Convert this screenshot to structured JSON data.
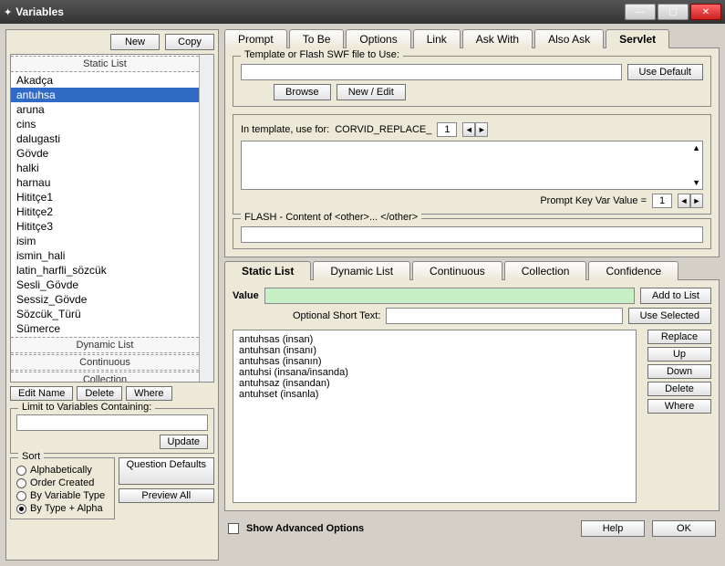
{
  "window": {
    "title": "Variables"
  },
  "left": {
    "new_btn": "New",
    "copy_btn": "Copy",
    "sections": {
      "static": "Static List",
      "dynamic": "Dynamic List",
      "continuous": "Continuous",
      "collection": "Collection"
    },
    "static_items": [
      "Akadça",
      "antuhsa",
      "aruna",
      "cins",
      "dalugasti",
      "Gövde",
      "halki",
      "harnau",
      "Hititçe1",
      "Hititçe2",
      "Hititçe3",
      "isim",
      "ismin_hali",
      "latin_harfli_sözcük",
      "Sesli_Gövde",
      "Sessiz_Gövde",
      "Sözcük_Türü",
      "Sümerce"
    ],
    "selected_static": "antuhsa",
    "editname_btn": "Edit Name",
    "delete_btn": "Delete",
    "where_btn": "Where",
    "limit_label": "Limit to Variables Containing:",
    "update_btn": "Update",
    "sort": {
      "legend": "Sort",
      "alpha": "Alphabetically",
      "order": "Order Created",
      "type": "By Variable Type",
      "typealpha": "By Type + Alpha",
      "selected": "typealpha"
    },
    "question_defaults_btn": "Question Defaults",
    "preview_all_btn": "Preview All"
  },
  "tabs_top": {
    "prompt": "Prompt",
    "tobe": "To Be",
    "options": "Options",
    "link": "Link",
    "askwith": "Ask With",
    "alsoask": "Also Ask",
    "servlet": "Servlet",
    "active": "servlet"
  },
  "servlet": {
    "template_legend": "Template or Flash SWF file to Use:",
    "use_default_btn": "Use Default",
    "browse_btn": "Browse",
    "newedit_btn": "New / Edit",
    "intemplate_label": "In template, use for:",
    "replace_token": "CORVID_REPLACE_",
    "spin_val": "1",
    "promptkey_label": "Prompt Key Var Value =",
    "promptkey_val": "1",
    "flash_label": "FLASH - Content of <other>... </other>"
  },
  "tabs_mid": {
    "static": "Static List",
    "dynamic": "Dynamic List",
    "continuous": "Continuous",
    "collection": "Collection",
    "confidence": "Confidence",
    "active": "static"
  },
  "value": {
    "label": "Value",
    "addtolist_btn": "Add to List",
    "shorttext_label": "Optional Short Text:",
    "useselected_btn": "Use Selected",
    "replace_btn": "Replace",
    "up_btn": "Up",
    "down_btn": "Down",
    "delete_btn": "Delete",
    "where_btn": "Where",
    "items": [
      "antuhsas (insan)",
      "antuhsan (insanı)",
      "antuhsas (insanın)",
      "antuhsi (insana/insanda)",
      "antuhsaz (insandan)",
      "antuhset (insanla)"
    ]
  },
  "bottom": {
    "showadv_label": "Show Advanced Options",
    "help_btn": "Help",
    "ok_btn": "OK"
  }
}
